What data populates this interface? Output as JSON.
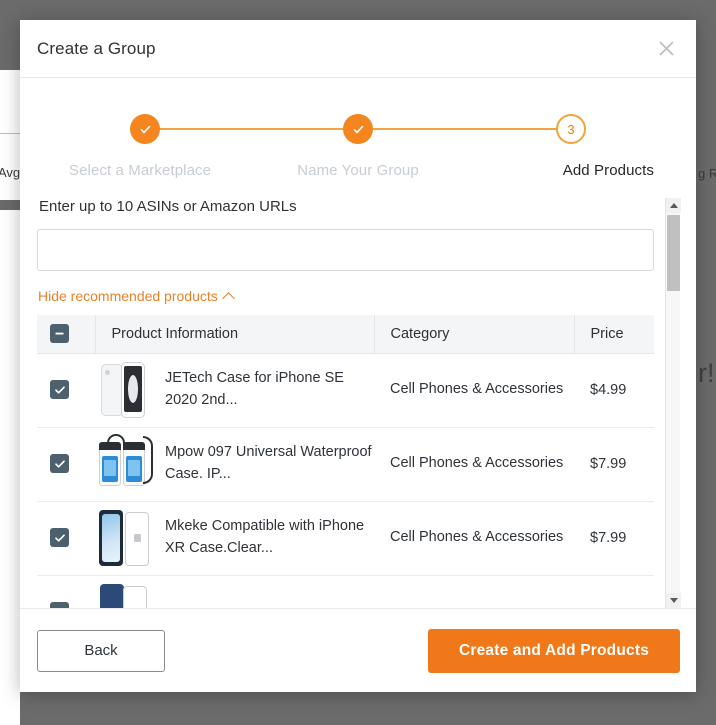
{
  "background": {
    "fragment_left": "Avg",
    "fragment_right_top": "g R",
    "fragment_right_bottom": "r!"
  },
  "modal": {
    "title": "Create a Group",
    "close_icon": "close-icon",
    "stepper": {
      "steps": [
        {
          "label": "Select a Marketplace",
          "state": "done",
          "marker": "✓"
        },
        {
          "label": "Name Your Group",
          "state": "done",
          "marker": "✓"
        },
        {
          "label": "Add Products",
          "state": "current",
          "marker": "3"
        }
      ],
      "accent": "#f5861f",
      "line_color": "#f3a33f"
    },
    "asin": {
      "label": "Enter up to 10 ASINs or Amazon URLs",
      "value": "",
      "placeholder": ""
    },
    "toggle_recommended": {
      "label": "Hide recommended products",
      "icon": "chevron-up-icon",
      "color": "#e8822a"
    },
    "table": {
      "select_all_state": "indeterminate",
      "columns": [
        "Product Information",
        "Category",
        "Price"
      ],
      "rows": [
        {
          "checked": true,
          "thumb": "iphone-se-clear-case-thumb",
          "name": "JETech Case for iPhone SE 2020 2nd...",
          "category": "Cell Phones & Accessories",
          "price": "$4.99"
        },
        {
          "checked": true,
          "thumb": "waterproof-pouch-thumb",
          "name": "Mpow 097 Universal Waterproof Case. IP...",
          "category": "Cell Phones & Accessories",
          "price": "$7.99"
        },
        {
          "checked": true,
          "thumb": "iphone-xr-clear-case-thumb",
          "name": "Mkeke Compatible with iPhone XR Case.Clear...",
          "category": "Cell Phones & Accessories",
          "price": "$7.99"
        }
      ]
    },
    "footer": {
      "back_label": "Back",
      "submit_label": "Create and Add Products",
      "submit_color": "#f07818"
    }
  }
}
